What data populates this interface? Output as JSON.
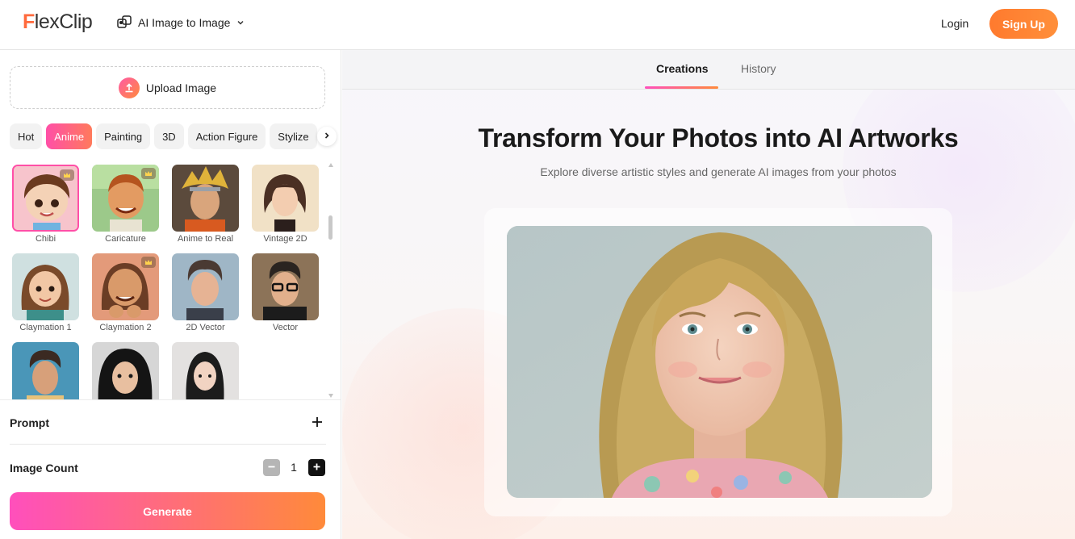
{
  "header": {
    "logo_text": "lexClip",
    "logo_initial": "F",
    "tool_selector": "AI Image to Image",
    "login": "Login",
    "signup": "Sign Up"
  },
  "left_panel": {
    "upload_label": "Upload Image",
    "category_tabs": [
      "Hot",
      "Anime",
      "Painting",
      "3D",
      "Action Figure",
      "Stylize"
    ],
    "active_tab": "Anime",
    "styles": [
      {
        "label": "Chibi",
        "selected": true,
        "premium": true
      },
      {
        "label": "Caricature",
        "premium": true
      },
      {
        "label": "Anime to Real"
      },
      {
        "label": "Vintage 2D"
      },
      {
        "label": "Claymation 1"
      },
      {
        "label": "Claymation 2",
        "premium": true
      },
      {
        "label": "2D Vector"
      },
      {
        "label": "Vector"
      },
      {
        "label": ""
      },
      {
        "label": ""
      },
      {
        "label": ""
      }
    ],
    "prompt_label": "Prompt",
    "image_count_label": "Image Count",
    "image_count_value": "1",
    "generate_label": "Generate"
  },
  "right_panel": {
    "tabs": [
      "Creations",
      "History"
    ],
    "active_tab": "Creations",
    "title": "Transform Your Photos into AI Artworks",
    "subtitle": "Explore diverse artistic styles and generate AI images from your photos"
  },
  "colors": {
    "accent_orange": "#ff7a2e",
    "accent_pink": "#ff4fa7",
    "gradient_start": "#ff4fbc",
    "gradient_end": "#ff8a3a"
  }
}
